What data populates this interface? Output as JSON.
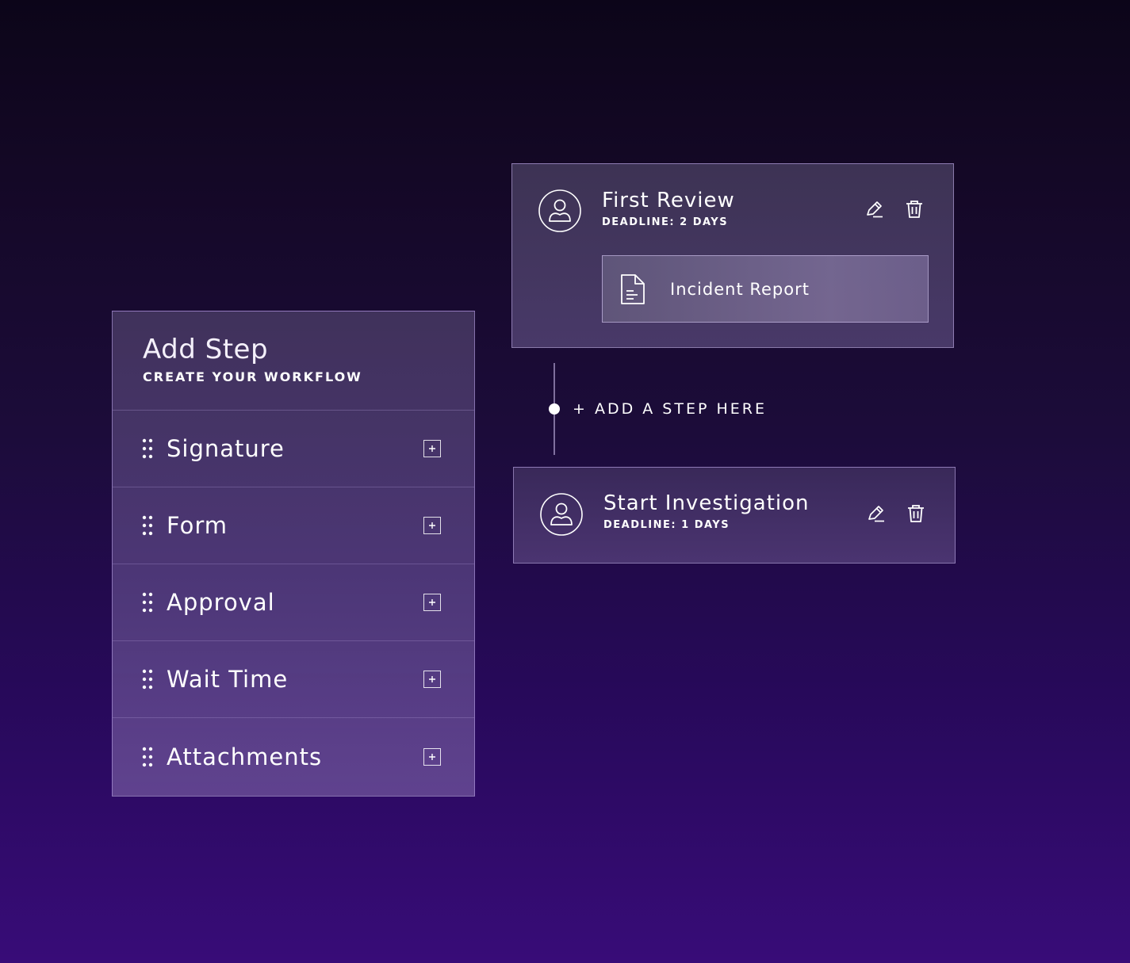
{
  "add_step_panel": {
    "title": "Add Step",
    "subtitle": "CREATE YOUR WORKFLOW",
    "items": [
      {
        "label": "Signature",
        "drag_icon": "drag-handle-icon",
        "add_icon": "plus-box-icon"
      },
      {
        "label": "Form",
        "drag_icon": "drag-handle-icon",
        "add_icon": "plus-box-icon"
      },
      {
        "label": "Approval",
        "drag_icon": "drag-handle-icon",
        "add_icon": "plus-box-icon"
      },
      {
        "label": "Wait Time",
        "drag_icon": "drag-handle-icon",
        "add_icon": "plus-box-icon"
      },
      {
        "label": "Attachments",
        "drag_icon": "drag-handle-icon",
        "add_icon": "plus-box-icon"
      }
    ]
  },
  "workflow": {
    "steps": [
      {
        "title": "First Review",
        "deadline": "DEADLINE: 2 DAYS",
        "avatar_icon": "user-icon",
        "actions": [
          "edit-icon",
          "trash-icon"
        ],
        "attachment": {
          "label": "Incident Report",
          "icon": "document-icon"
        }
      },
      {
        "title": "Start Investigation",
        "deadline": "DEADLINE: 1 DAYS",
        "avatar_icon": "user-icon",
        "actions": [
          "edit-icon",
          "trash-icon"
        ]
      }
    ],
    "add_step_here": "+ ADD A STEP HERE"
  },
  "colors": {
    "background_top": "#0c0519",
    "background_bottom": "#380c78",
    "panel_border": "#bea5eb",
    "text": "#ffffff"
  }
}
